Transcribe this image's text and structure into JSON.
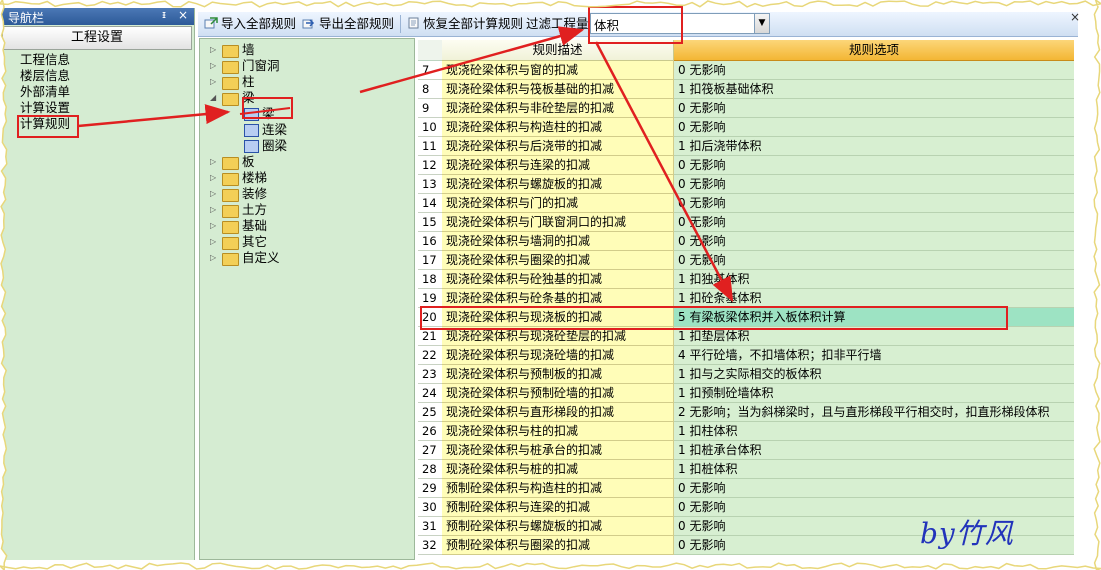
{
  "nav": {
    "title": "导航栏",
    "pin": "ᵻ",
    "close": "×",
    "section": "工程设置",
    "items": [
      "工程信息",
      "楼层信息",
      "外部清单",
      "计算设置",
      "计算规则"
    ]
  },
  "toolbar": {
    "import_label": "导入全部规则",
    "export_label": "导出全部规则",
    "restore_label": "恢复全部计算规则",
    "filter_label": "过滤工程量",
    "filter_value": "体积",
    "close": "×"
  },
  "tree": {
    "items": [
      {
        "label": "墙",
        "expander": "▷",
        "expanded": false
      },
      {
        "label": "门窗洞",
        "expander": "▷",
        "expanded": false
      },
      {
        "label": "柱",
        "expander": "▷",
        "expanded": false
      },
      {
        "label": "梁",
        "expander": "◢",
        "expanded": true
      },
      {
        "label": "板",
        "expander": "▷",
        "expanded": false
      },
      {
        "label": "楼梯",
        "expander": "▷",
        "expanded": false
      },
      {
        "label": "装修",
        "expander": "▷",
        "expanded": false
      },
      {
        "label": "土方",
        "expander": "▷",
        "expanded": false
      },
      {
        "label": "基础",
        "expander": "▷",
        "expanded": false
      },
      {
        "label": "其它",
        "expander": "▷",
        "expanded": false
      },
      {
        "label": "自定义",
        "expander": "▷",
        "expanded": false
      }
    ],
    "beam_children": [
      "梁",
      "连梁",
      "圈梁"
    ]
  },
  "table": {
    "header_desc": "规则描述",
    "header_option": "规则选项",
    "selected_row": "20",
    "rows": [
      {
        "num": "7",
        "desc": "现浇砼梁体积与窗的扣减",
        "opt": "0  无影响"
      },
      {
        "num": "8",
        "desc": "现浇砼梁体积与筏板基础的扣减",
        "opt": "1  扣筏板基础体积"
      },
      {
        "num": "9",
        "desc": "现浇砼梁体积与非砼垫层的扣减",
        "opt": "0  无影响"
      },
      {
        "num": "10",
        "desc": "现浇砼梁体积与构造柱的扣减",
        "opt": "0  无影响"
      },
      {
        "num": "11",
        "desc": "现浇砼梁体积与后浇带的扣减",
        "opt": "1  扣后浇带体积"
      },
      {
        "num": "12",
        "desc": "现浇砼梁体积与连梁的扣减",
        "opt": "0  无影响"
      },
      {
        "num": "13",
        "desc": "现浇砼梁体积与螺旋板的扣减",
        "opt": "0  无影响"
      },
      {
        "num": "14",
        "desc": "现浇砼梁体积与门的扣减",
        "opt": "0  无影响"
      },
      {
        "num": "15",
        "desc": "现浇砼梁体积与门联窗洞口的扣减",
        "opt": "0  无影响"
      },
      {
        "num": "16",
        "desc": "现浇砼梁体积与墙洞的扣减",
        "opt": "0  无影响"
      },
      {
        "num": "17",
        "desc": "现浇砼梁体积与圈梁的扣减",
        "opt": "0  无影响"
      },
      {
        "num": "18",
        "desc": "现浇砼梁体积与砼独基的扣减",
        "opt": "1  扣独基体积"
      },
      {
        "num": "19",
        "desc": "现浇砼梁体积与砼条基的扣减",
        "opt": "1  扣砼条基体积"
      },
      {
        "num": "20",
        "desc": "现浇砼梁体积与现浇板的扣减",
        "opt": "5  有梁板梁体积并入板体积计算"
      },
      {
        "num": "21",
        "desc": "现浇砼梁体积与现浇砼垫层的扣减",
        "opt": "1  扣垫层体积"
      },
      {
        "num": "22",
        "desc": "现浇砼梁体积与现浇砼墙的扣减",
        "opt": "4  平行砼墙，不扣墙体积；扣非平行墙"
      },
      {
        "num": "23",
        "desc": "现浇砼梁体积与预制板的扣减",
        "opt": "1  扣与之实际相交的板体积"
      },
      {
        "num": "24",
        "desc": "现浇砼梁体积与预制砼墙的扣减",
        "opt": "1   扣预制砼墙体积"
      },
      {
        "num": "25",
        "desc": "现浇砼梁体积与直形梯段的扣减",
        "opt": "2  无影响；当为斜梯梁时，且与直形梯段平行相交时，扣直形梯段体积"
      },
      {
        "num": "26",
        "desc": "现浇砼梁体积与柱的扣减",
        "opt": "1  扣柱体积"
      },
      {
        "num": "27",
        "desc": "现浇砼梁体积与桩承台的扣减",
        "opt": "1  扣桩承台体积"
      },
      {
        "num": "28",
        "desc": "现浇砼梁体积与桩的扣减",
        "opt": "1  扣桩体积"
      },
      {
        "num": "29",
        "desc": "预制砼梁体积与构造柱的扣减",
        "opt": "0   无影响"
      },
      {
        "num": "30",
        "desc": "预制砼梁体积与连梁的扣减",
        "opt": "0   无影响"
      },
      {
        "num": "31",
        "desc": "预制砼梁体积与螺旋板的扣减",
        "opt": "0   无影响"
      },
      {
        "num": "32",
        "desc": "预制砼梁体积与圈梁的扣减",
        "opt": "0   无影响"
      }
    ]
  },
  "signature": "by竹风",
  "colors": {
    "panel_green": "#d5ecd2",
    "desc_yellow": "#fffdb8",
    "option_green": "#d7efd1",
    "header_orange": "#f3b634",
    "selected": "#9de3c3",
    "annotation_red": "#e02020",
    "signature_blue": "#2233bb"
  }
}
